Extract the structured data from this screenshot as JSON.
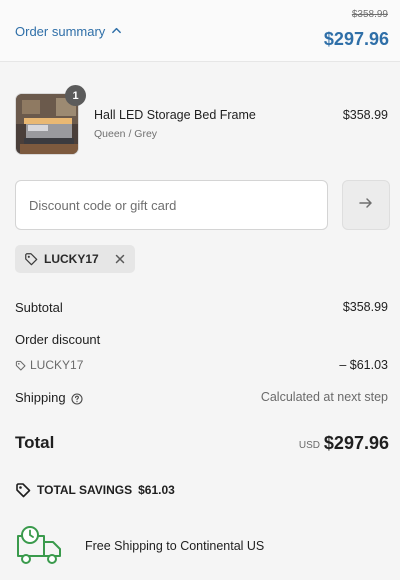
{
  "header": {
    "toggle_label": "Order summary",
    "compare_price": "$358.99",
    "total": "$297.96"
  },
  "product": {
    "name": "Hall LED Storage Bed Frame",
    "variant": "Queen / Grey",
    "price": "$358.99",
    "quantity": "1"
  },
  "discount": {
    "placeholder": "Discount code or gift card",
    "value": "",
    "applied_code": "LUCKY17"
  },
  "summary": {
    "subtotal_label": "Subtotal",
    "subtotal_value": "$358.99",
    "order_discount_label": "Order discount",
    "discount_code": "LUCKY17",
    "discount_value": "– $61.03",
    "shipping_label": "Shipping",
    "shipping_value": "Calculated at next step",
    "total_label": "Total",
    "total_currency": "USD",
    "total_value": "$297.96"
  },
  "savings": {
    "label": "TOTAL SAVINGS",
    "amount": "$61.03"
  },
  "promo": {
    "text": "Free Shipping to Continental US"
  },
  "colors": {
    "accent": "#2f6fa8",
    "promo_green": "#3a9a4c"
  }
}
